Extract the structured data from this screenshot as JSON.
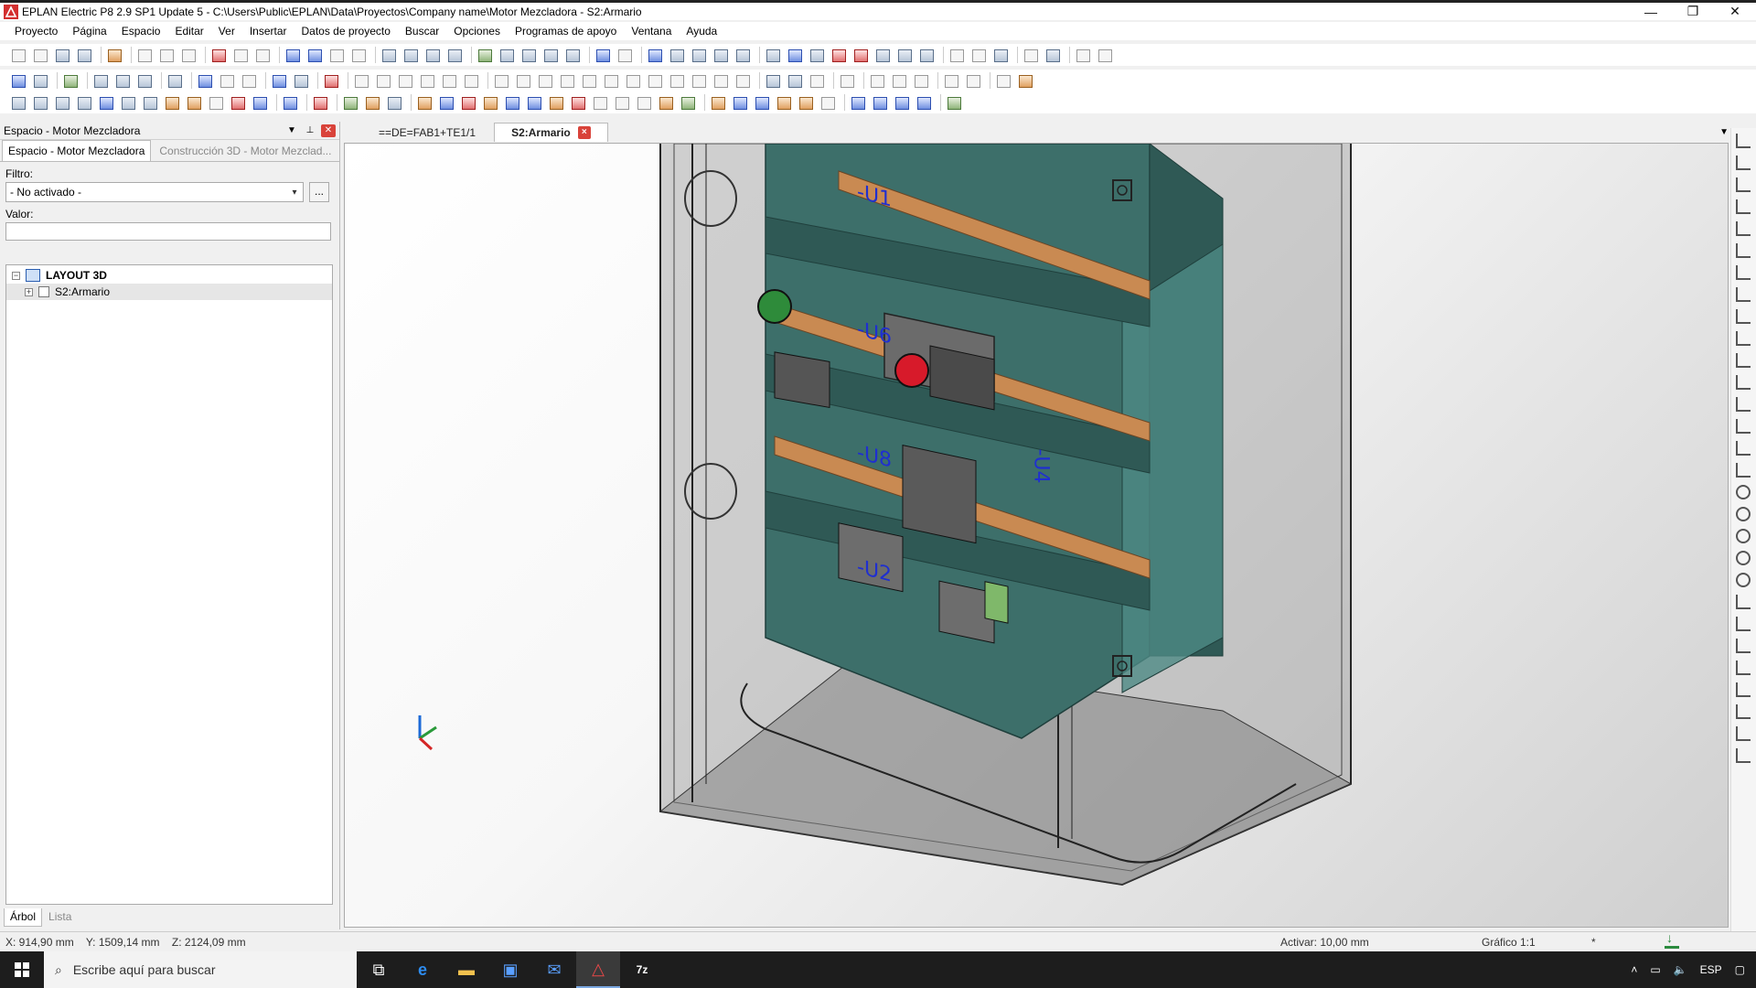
{
  "window": {
    "title": "EPLAN Electric P8 2.9 SP1 Update 5 - C:\\Users\\Public\\EPLAN\\Data\\Proyectos\\Company name\\Motor Mezcladora - S2:Armario",
    "minimize": "—",
    "restore": "❐",
    "close": "✕"
  },
  "menu": [
    "Proyecto",
    "Página",
    "Espacio",
    "Editar",
    "Ver",
    "Insertar",
    "Datos de proyecto",
    "Buscar",
    "Opciones",
    "Programas de apoyo",
    "Ventana",
    "Ayuda"
  ],
  "left_panel": {
    "header": "Espacio - Motor Mezcladora",
    "tabs": [
      "Espacio - Motor Mezcladora",
      "Construcción 3D - Motor Mezclad..."
    ],
    "filter_label": "Filtro:",
    "filter_value": "- No activado -",
    "filter_button": "...",
    "value_label": "Valor:",
    "tree": [
      {
        "label": "LAYOUT 3D",
        "expander": "−"
      },
      {
        "label": "S2:Armario",
        "expander": "+"
      }
    ],
    "bottom_tabs": [
      "Árbol",
      "Lista"
    ]
  },
  "doc_tabs": [
    "==DE=FAB1+TE1/1",
    "S2:Armario"
  ],
  "doc_tab_close": "×",
  "doc_tab_dropdown": "▼",
  "viewport": {
    "labels": [
      "-U1",
      "-U6",
      "-U8",
      "-U2",
      "-U4"
    ]
  },
  "status": {
    "coords": "X: 914,90 mm    Y: 1509,14 mm    Z: 2124,09 mm",
    "grid": "Activar: 10,00 mm",
    "scale": "Gráfico 1:1",
    "star": "*"
  },
  "taskbar": {
    "search_placeholder": "Escribe aquí para buscar",
    "language": "ESP"
  }
}
